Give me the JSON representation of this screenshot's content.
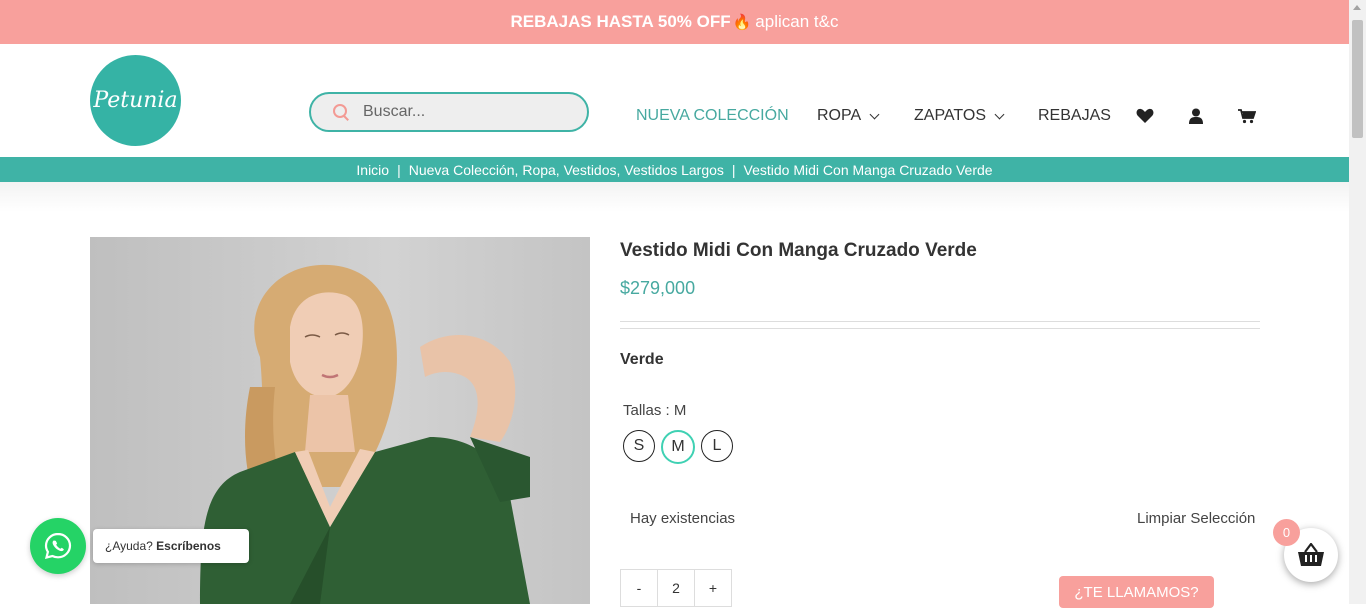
{
  "promo": {
    "bold": "REBAJAS HASTA 50% OFF",
    "flame_icon": "fire-icon",
    "rest": "aplican t&c"
  },
  "logo": {
    "text": "Petunia"
  },
  "search": {
    "placeholder": "Buscar..."
  },
  "nav": {
    "items": [
      "NUEVA COLECCIÓN",
      "ROPA",
      "ZAPATOS",
      "REBAJAS"
    ],
    "icons": [
      "heart-icon",
      "user-icon",
      "cart-icon"
    ]
  },
  "breadcrumb": {
    "home": "Inicio",
    "sep": "|",
    "categories": "Nueva Colección, Ropa, Vestidos, Vestidos Largos",
    "current": "Vestido Midi Con Manga Cruzado Verde"
  },
  "product": {
    "title": "Vestido Midi Con Manga Cruzado Verde",
    "price": "$279,000",
    "color": "Verde",
    "sizes_label": "Tallas : M",
    "sizes": [
      "S",
      "M",
      "L"
    ],
    "selected_size": "M",
    "stock": "Hay existencias",
    "clear": "Limpiar Selección",
    "qty_minus": "-",
    "qty_value": "2",
    "qty_plus": "+",
    "call_button": "¿TE LLAMAMOS?"
  },
  "whatsapp": {
    "prefix": "¿Ayuda?",
    "bold": "Escríbenos"
  },
  "cart": {
    "count": "0"
  },
  "colors": {
    "teal": "#3fb3a6",
    "pink": "#f8a09c",
    "whatsapp": "#25d366"
  }
}
